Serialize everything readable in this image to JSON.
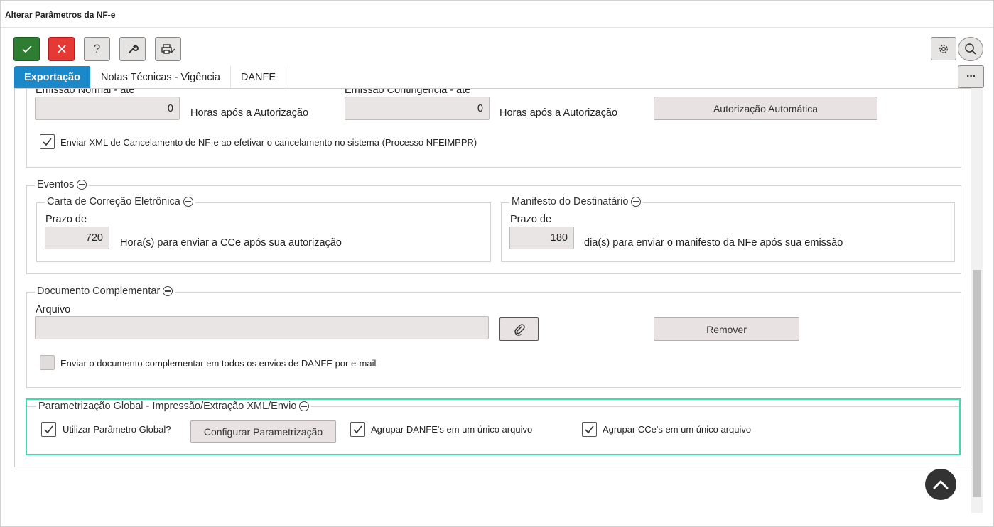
{
  "window": {
    "title": "Alterar Parâmetros da NF-e"
  },
  "toolbar": {
    "ok_icon": "check-icon",
    "cancel_icon": "close-icon",
    "help_label": "?",
    "tool_icon": "wrench-icon",
    "print_icon": "printer-icon",
    "settings_icon": "gear-icon",
    "search_icon": "search-icon",
    "more_label": "···"
  },
  "tabs": [
    {
      "label": "Exportação",
      "active": true
    },
    {
      "label": "Notas Técnicas - Vigência",
      "active": false
    },
    {
      "label": "DANFE",
      "active": false
    }
  ],
  "cancelamento": {
    "normal_label": "Emissão Normal - até",
    "normal_value": "0",
    "normal_suffix": "Horas após a Autorização",
    "contingencia_label": "Emissão Contingência - até",
    "contingencia_value": "0",
    "contingencia_suffix": "Horas após a Autorização",
    "auto_button": "Autorização Automática",
    "enviar_xml_label": "Enviar XML de Cancelamento de NF-e ao efetivar o cancelamento no sistema (Processo NFEIMPPR)",
    "enviar_xml_checked": true
  },
  "eventos": {
    "legend": "Eventos",
    "cce": {
      "legend": "Carta de Correção Eletrônica",
      "prazo_label": "Prazo de",
      "prazo_value": "720",
      "suffix": "Hora(s) para enviar a CCe após sua autorização"
    },
    "manifesto": {
      "legend": "Manifesto do Destinatário",
      "prazo_label": "Prazo de",
      "prazo_value": "180",
      "suffix": "dia(s) para enviar o manifesto da NFe após sua emissão"
    }
  },
  "documento": {
    "legend": "Documento Complementar",
    "arquivo_label": "Arquivo",
    "arquivo_value": "",
    "attach_icon": "paperclip-icon",
    "remover_button": "Remover",
    "enviar_label": "Enviar o documento complementar em todos os envios de DANFE por e-mail",
    "enviar_checked": false
  },
  "global": {
    "legend": "Parametrização Global - Impressão/Extração XML/Envio",
    "utilizar_label": "Utilizar Parâmetro Global?",
    "utilizar_checked": true,
    "configurar_button": "Configurar Parametrização",
    "agrupar_danfe_label": "Agrupar DANFE's em um único arquivo",
    "agrupar_danfe_checked": true,
    "agrupar_cce_label": "Agrupar CCe's em um único arquivo",
    "agrupar_cce_checked": true
  },
  "scroll_top_icon": "chevron-up-icon",
  "colors": {
    "tab_active": "#1a88c9",
    "ok": "#2e7d32",
    "cancel": "#e53935",
    "highlight": "#3ddbae"
  }
}
